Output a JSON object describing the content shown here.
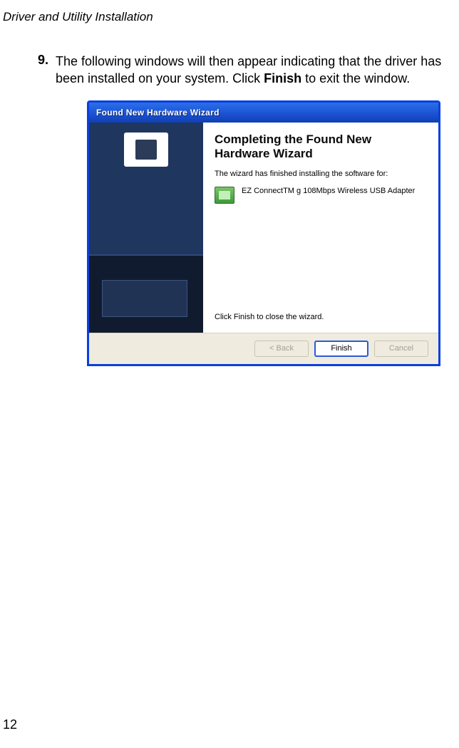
{
  "header": {
    "title": "Driver and Utility Installation"
  },
  "step": {
    "number": "9.",
    "text_before": "The following windows will then appear indicating that the driver has been installed on your system. Click ",
    "bold": "Finish",
    "text_after": " to exit the window."
  },
  "wizard": {
    "titlebar": "Found New Hardware Wizard",
    "heading": "Completing the Found New Hardware Wizard",
    "subtext": "The wizard has finished installing the software for:",
    "device_name": "EZ ConnectTM g 108Mbps Wireless USB Adapter",
    "footer_text": "Click Finish to close the wizard.",
    "buttons": {
      "back": "< Back",
      "finish": "Finish",
      "cancel": "Cancel"
    }
  },
  "page_number": "12"
}
